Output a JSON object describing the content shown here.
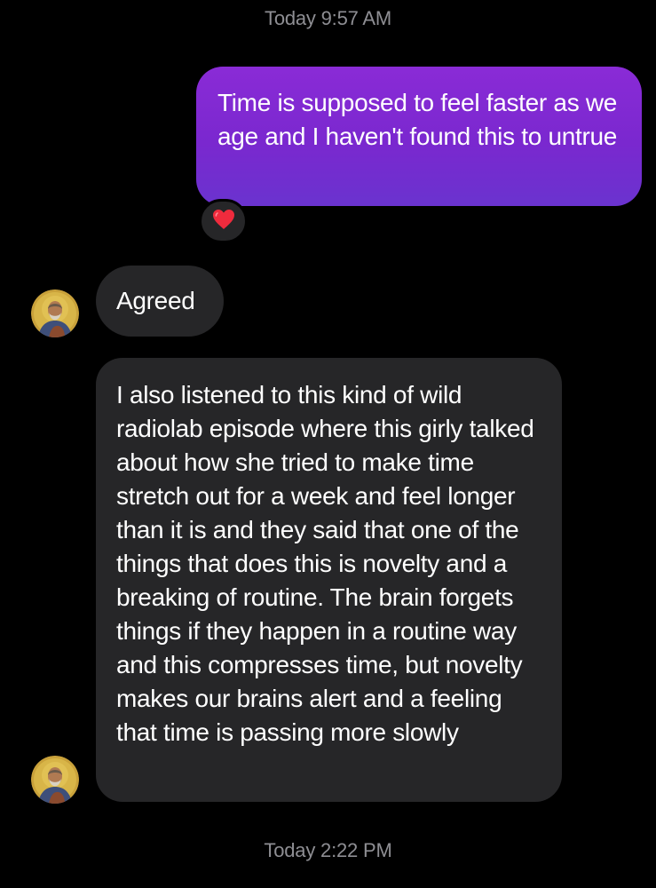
{
  "conversation": {
    "timestamp_top": "Today 9:57 AM",
    "timestamp_bottom": "Today 2:22 PM",
    "messages": [
      {
        "direction": "outgoing",
        "text": "Time is supposed to feel faster as we age and I haven't found this to untrue",
        "reaction": "❤️"
      },
      {
        "direction": "incoming",
        "text": "Agreed"
      },
      {
        "direction": "incoming",
        "text": "I also listened to this kind of wild radiolab episode where this girly talked about how she tried to make time stretch out for a week and feel longer than it is and they said that one of the things that does this is novelty and a breaking of routine. The brain forgets things if they happen in a routine way and this compresses time, but novelty makes our brains alert and a feeling that time is passing more slowly"
      }
    ]
  },
  "colors": {
    "background": "#000000",
    "outgoing_bubble": "#7a28cf",
    "incoming_bubble": "#262628",
    "timestamp": "#8e8e93"
  },
  "icons": {
    "avatar": "saint-icon-avatar",
    "reaction": "heart-icon"
  }
}
